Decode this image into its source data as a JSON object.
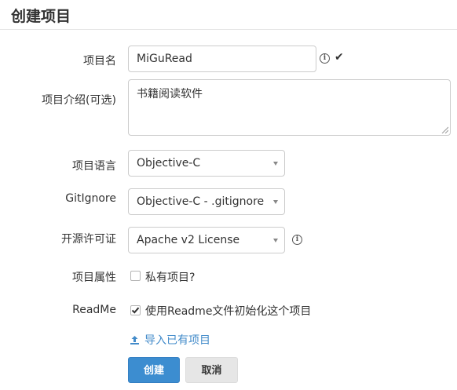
{
  "page": {
    "title": "创建项目"
  },
  "form": {
    "name": {
      "label": "项目名",
      "value": "MiGuRead"
    },
    "description": {
      "label": "项目介绍(可选)",
      "value": "书籍阅读软件"
    },
    "language": {
      "label": "项目语言",
      "selected": "Objective-C"
    },
    "gitignore": {
      "label": "GitIgnore",
      "selected": "Objective-C - .gitignore"
    },
    "license": {
      "label": "开源许可证",
      "selected": "Apache v2 License"
    },
    "visibility": {
      "label": "项目属性",
      "checkbox_label": "私有项目?",
      "checked": false
    },
    "readme": {
      "label": "ReadMe",
      "checkbox_label": "使用Readme文件初始化这个项目",
      "checked": true
    },
    "import_link": "导入已有项目",
    "create_button": "创建",
    "cancel_button": "取消"
  },
  "icons": {
    "info": "info-circle-icon",
    "valid": "checkmark-icon",
    "upload": "upload-icon"
  },
  "colors": {
    "primary": "#3c8dd0",
    "link": "#428bca",
    "border": "#cccccc"
  }
}
